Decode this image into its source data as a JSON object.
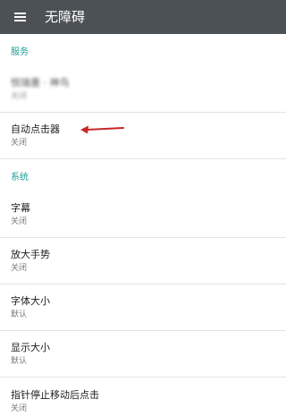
{
  "toolbar": {
    "title": "无障碍",
    "menu_icon": "hamburger-menu-icon"
  },
  "sections": {
    "services": {
      "header": "服务",
      "items": [
        {
          "title": "悦瑞墨 · 神鸟",
          "summary": "关闭"
        },
        {
          "title": "自动点击器",
          "summary": "关闭"
        }
      ]
    },
    "system": {
      "header": "系统",
      "items": [
        {
          "title": "字幕",
          "summary": "关闭"
        },
        {
          "title": "放大手势",
          "summary": "关闭"
        },
        {
          "title": "字体大小",
          "summary": "默认"
        },
        {
          "title": "显示大小",
          "summary": "默认"
        },
        {
          "title": "指针停止移动后点击",
          "summary": "关闭"
        }
      ]
    }
  },
  "colors": {
    "toolbar_bg": "#4b5155",
    "section_header": "#1f9f96",
    "annotation_arrow": "#c62828"
  },
  "annotation": {
    "arrow_icon": "red-arrow-icon"
  }
}
